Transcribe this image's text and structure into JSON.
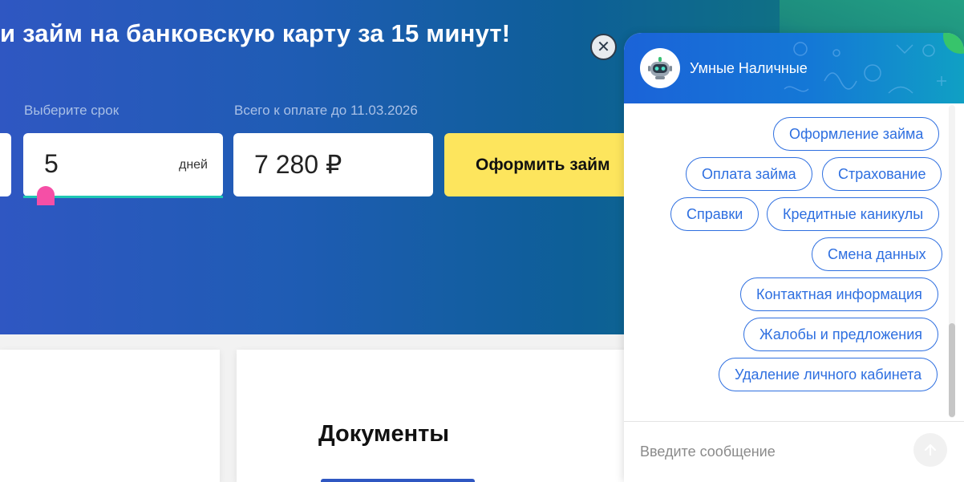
{
  "hero": {
    "title": "и займ на банковскую карту за 15 минут!",
    "term_label": "Выберите срок",
    "term_value": "5",
    "term_unit": "дней",
    "total_label": "Всего к оплате до 11.03.2026",
    "total_value": "7 280 ₽",
    "apply_button": "Оформить займ"
  },
  "documents": {
    "title": "Документы"
  },
  "chat": {
    "title": "Умные Наличные",
    "close_symbol": "✕",
    "chips": [
      "Оформление займа",
      "Оплата займа",
      "Страхование",
      "Справки",
      "Кредитные каникулы",
      "Смена данных",
      "Контактная информация",
      "Жалобы и предложения",
      "Удаление личного кабинета"
    ],
    "input_placeholder": "Введите сообщение"
  },
  "colors": {
    "accent_yellow": "#fde55d",
    "chat_blue": "#2e6fe0",
    "slider_knob": "#f54fa6",
    "slider_track": "#1ec7b4"
  },
  "icons": [
    "robot-avatar-icon",
    "close-icon",
    "send-arrow-icon"
  ]
}
